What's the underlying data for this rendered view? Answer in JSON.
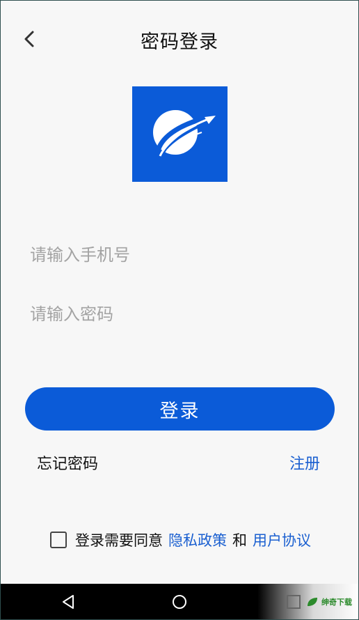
{
  "header": {
    "title": "密码登录",
    "back_icon": "chevron-left-icon"
  },
  "logo": {
    "brand_color": "#0b5bd8"
  },
  "form": {
    "phone_placeholder": "请输入手机号",
    "password_placeholder": "请输入密码",
    "login_label": "登录"
  },
  "links": {
    "forgot_password": "忘记密码",
    "register": "注册"
  },
  "agreement": {
    "prefix": "登录需要同意",
    "privacy": "隐私政策",
    "and": "和",
    "terms": "用户协议",
    "checked": false
  },
  "navbar": {
    "back_icon": "triangle-back-icon",
    "home_icon": "circle-home-icon",
    "recents_icon": "square-recents-icon"
  },
  "watermark": {
    "text": "绅奇下载"
  },
  "colors": {
    "accent": "#0b5bd8",
    "link": "#1a5fd0",
    "background": "#f7f7f7"
  }
}
